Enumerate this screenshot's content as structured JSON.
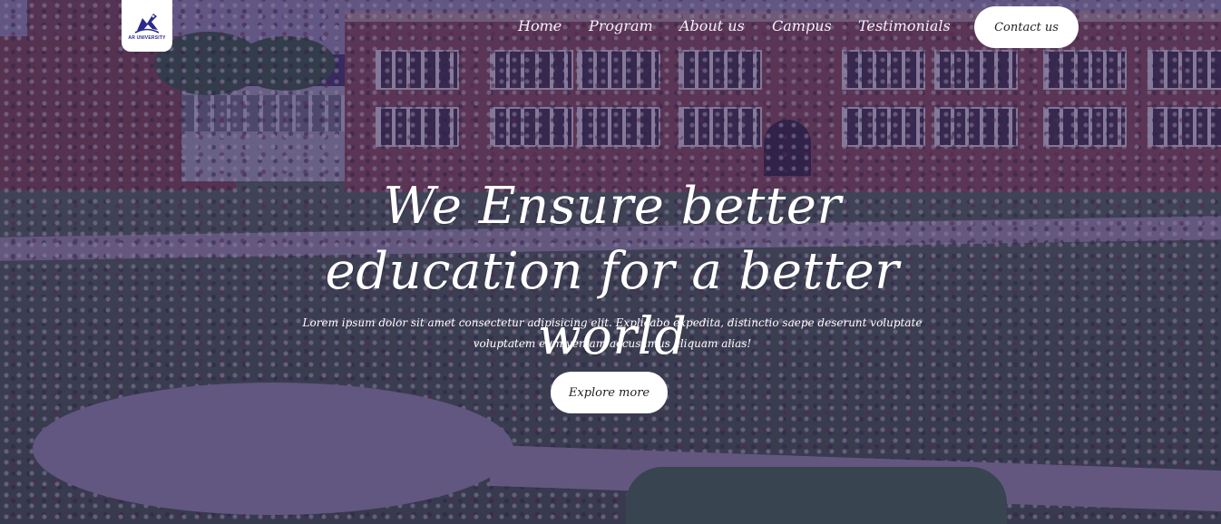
{
  "brand": {
    "logo_text": "AR UNIVERSITY",
    "logo_color": "#2d2a8c"
  },
  "nav": {
    "items": [
      {
        "label": "Home"
      },
      {
        "label": "Program"
      },
      {
        "label": "About us"
      },
      {
        "label": "Campus"
      },
      {
        "label": "Testimonials"
      }
    ],
    "contact_label": "Contact us"
  },
  "hero": {
    "headline": "We Ensure better education for a better world",
    "subtext": "Lorem ipsum dolor sit amet consectetur adipisicing elit. Explicabo expedita, distinctio saepe deserunt voluptate voluptatem eum veniam accusamus aliquam alias!",
    "cta_label": "Explore more",
    "overlay_color": "#342464"
  }
}
